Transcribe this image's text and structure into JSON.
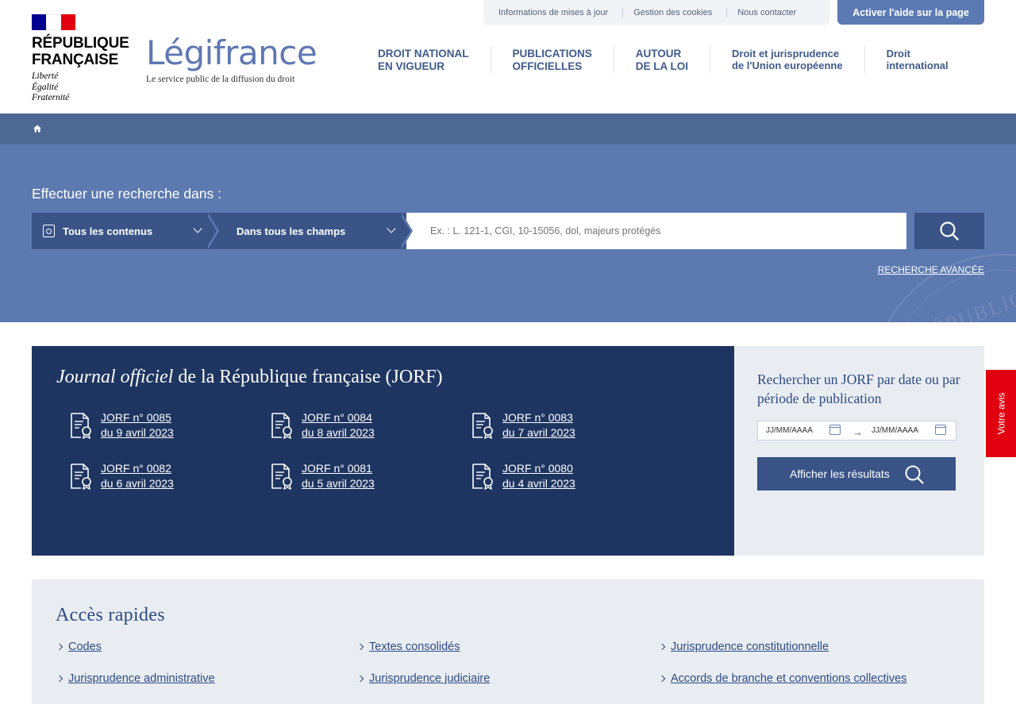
{
  "header": {
    "republic_line1": "RÉPUBLIQUE",
    "republic_line2": "FRANÇAISE",
    "motto_1": "Liberté",
    "motto_2": "Égalité",
    "motto_3": "Fraternité",
    "brand_name": "Légifrance",
    "brand_tagline": "Le service public de la diffusion du droit",
    "top_links": [
      "Informations de mises à jour",
      "Gestion des cookies",
      "Nous contacter"
    ],
    "help_button": "Activer l'aide sur la page",
    "nav": [
      {
        "line1": "DROIT NATIONAL",
        "line2": "EN VIGUEUR"
      },
      {
        "line1": "PUBLICATIONS",
        "line2": "OFFICIELLES"
      },
      {
        "line1": "AUTOUR",
        "line2": "DE LA LOI"
      },
      {
        "line1": "Droit et jurisprudence",
        "line2": "de l'Union européenne"
      },
      {
        "line1": "Droit",
        "line2": "international"
      }
    ]
  },
  "search": {
    "title": "Effectuer une recherche dans :",
    "scope_select": "Tous les contenus",
    "field_select": "Dans tous les champs",
    "placeholder": "Ex. : L. 121-1, CGI, 10-15056, dol, majeurs protégés",
    "advanced": "RECHERCHE AVANCÉE",
    "seal_text": "RÉPUBLIQUE"
  },
  "jorf": {
    "title_italic": "Journal officiel",
    "title_rest": " de la République française (JORF)",
    "items": [
      {
        "number": "JORF n° 0085",
        "date": "du 9 avril 2023"
      },
      {
        "number": "JORF n° 0084",
        "date": "du 8 avril 2023"
      },
      {
        "number": "JORF n° 0083",
        "date": "du 7 avril 2023"
      },
      {
        "number": "JORF n° 0082",
        "date": "du 6 avril 2023"
      },
      {
        "number": "JORF n° 0081",
        "date": "du 5 avril 2023"
      },
      {
        "number": "JORF n° 0080",
        "date": "du 4 avril 2023"
      }
    ],
    "side_title": "Rechercher un JORF par date ou par période de publication",
    "date_from_placeholder": "JJ/MM/AAAA",
    "date_to_placeholder": "JJ/MM/AAAA",
    "show_results": "Afficher les résultats"
  },
  "feedback_tab": "Votre avis",
  "quick_access": {
    "title": "Accès rapides",
    "links": [
      "Codes",
      "Textes consolidés",
      "Jurisprudence constitutionnelle",
      "Jurisprudence administrative",
      "Jurisprudence judiciaire",
      "Accords de branche et conventions collectives"
    ]
  },
  "colors": {
    "primary_blue": "#3a5488",
    "hero_blue": "#5c79b0",
    "dark_navy": "#1f3561",
    "accent_red": "#e1000f"
  }
}
